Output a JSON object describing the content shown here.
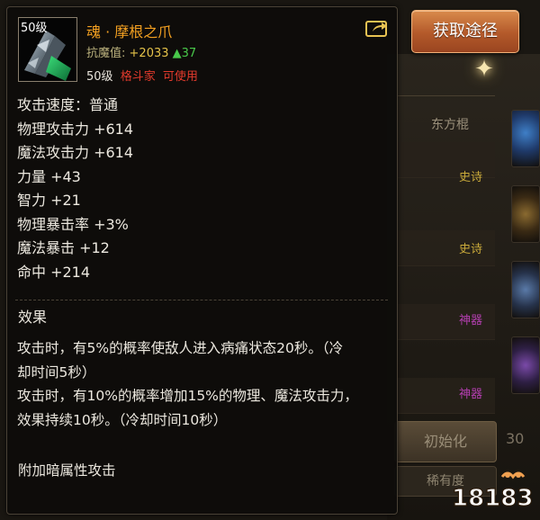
{
  "obtain_button": {
    "label": "获取途径"
  },
  "item": {
    "level_badge": "50级",
    "name": "魂 · 摩根之爪",
    "resist_label": "抗魔值:",
    "resist_value": "+2033",
    "resist_delta": "▲37",
    "level_req": "50级",
    "class_req": "格斗家",
    "usable": "可使用"
  },
  "stats": [
    "攻击速度：普通",
    "物理攻击力 +614",
    "魔法攻击力 +614",
    "力量 +43",
    "智力 +21",
    "物理暴击率 +3%",
    "魔法暴击 +12",
    "命中 +214"
  ],
  "effect": {
    "title": "效果",
    "lines": [
      "攻击时，有5%的概率使敌人进入病痛状态20秒。（冷",
      "却时间5秒）",
      "攻击时，有10%的概率增加15%的物理、魔法攻击力，",
      "效果持续10秒。（冷却时间10秒）"
    ],
    "extra": "附加暗属性攻击"
  },
  "background": {
    "column_header": "东方棍",
    "tags": [
      "史诗",
      "史诗",
      "神器",
      "神器"
    ],
    "init_button": "初始化",
    "init_number": "30",
    "sort_button": "稀有度",
    "watermark": "18183"
  },
  "colors": {
    "item_name": "#f3a021",
    "warning_red": "#e23a2c",
    "increase_green": "#48c84a",
    "epic_gold": "#c9a93a",
    "legend_purple": "#b43fb0"
  },
  "icons": {
    "share": "share-icon",
    "weapon": "claw-weapon-icon",
    "sparkle": "sparkle-icon"
  }
}
